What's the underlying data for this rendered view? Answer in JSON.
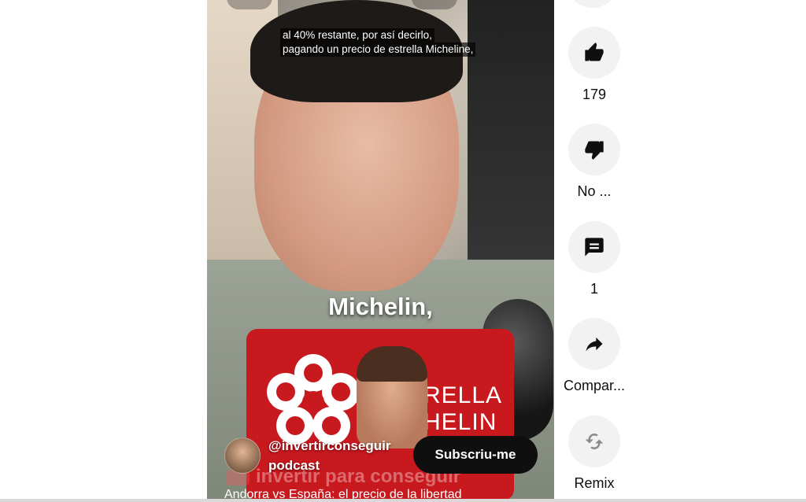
{
  "video": {
    "caption_line1": "al 40% restante, por así decirlo,",
    "caption_line2": "pagando un precio de estrella Micheline,",
    "big_caption": "Michelin,",
    "card_line1": "RELLA",
    "card_line2": "HELIN",
    "channel_handle": "@invertirconseguir",
    "channel_subtitle": "podcast",
    "subscribe_label": "Subscriu-me",
    "watermark": "invertir para conseguir",
    "title": "Andorra vs España: el precio de la libertad"
  },
  "actions": [
    {
      "name": "like",
      "icon": "thumb-up-icon",
      "label": "179"
    },
    {
      "name": "dislike",
      "icon": "thumb-down-icon",
      "label": "No ..."
    },
    {
      "name": "comments",
      "icon": "comment-icon",
      "label": "1"
    },
    {
      "name": "share",
      "icon": "share-arrow-icon",
      "label": "Compar..."
    },
    {
      "name": "remix",
      "icon": "remix-icon",
      "label": "Remix"
    }
  ],
  "colors": {
    "card_red": "#c8191f",
    "button_bg": "#f2f2f2",
    "subscribe_bg": "#0f0f0f"
  }
}
